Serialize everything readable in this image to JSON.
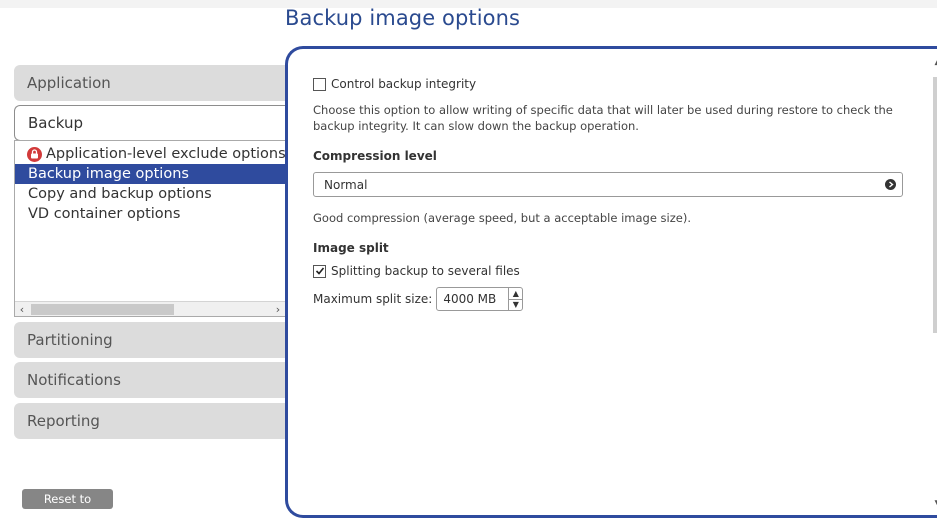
{
  "header": {
    "title": "Backup image options"
  },
  "nav": {
    "sections": [
      {
        "label": "Application"
      },
      {
        "label": "Backup"
      },
      {
        "label": "Partitioning"
      },
      {
        "label": "Notifications"
      },
      {
        "label": "Reporting"
      }
    ],
    "backup_items": [
      {
        "label": "Application-level exclude options"
      },
      {
        "label": "Backup image options"
      },
      {
        "label": "Copy and backup options"
      },
      {
        "label": "VD container options"
      }
    ],
    "reset_label": "Reset to default"
  },
  "panel": {
    "integrity_label": "Control backup integrity",
    "integrity_checked": false,
    "integrity_desc": "Choose this option to allow writing of specific data that will later be used during restore to check the backup integrity. It can slow down the backup operation.",
    "compression_title": "Compression level",
    "compression_value": "Normal",
    "compression_desc": "Good compression (average speed, but a acceptable image size).",
    "split_title": "Image split",
    "split_label": "Splitting backup to several files",
    "split_checked": true,
    "max_split_label": "Maximum split size:",
    "max_split_value": "4000 MB"
  },
  "colors": {
    "accent": "#2f4b9e",
    "nav_bg": "#dcdcdc",
    "lock": "#d23a3a"
  },
  "icons": {
    "lock": "lock-icon",
    "select": "chevron-right-circle-icon",
    "spin_up": "chevron-up-icon",
    "spin_down": "chevron-down-icon"
  }
}
